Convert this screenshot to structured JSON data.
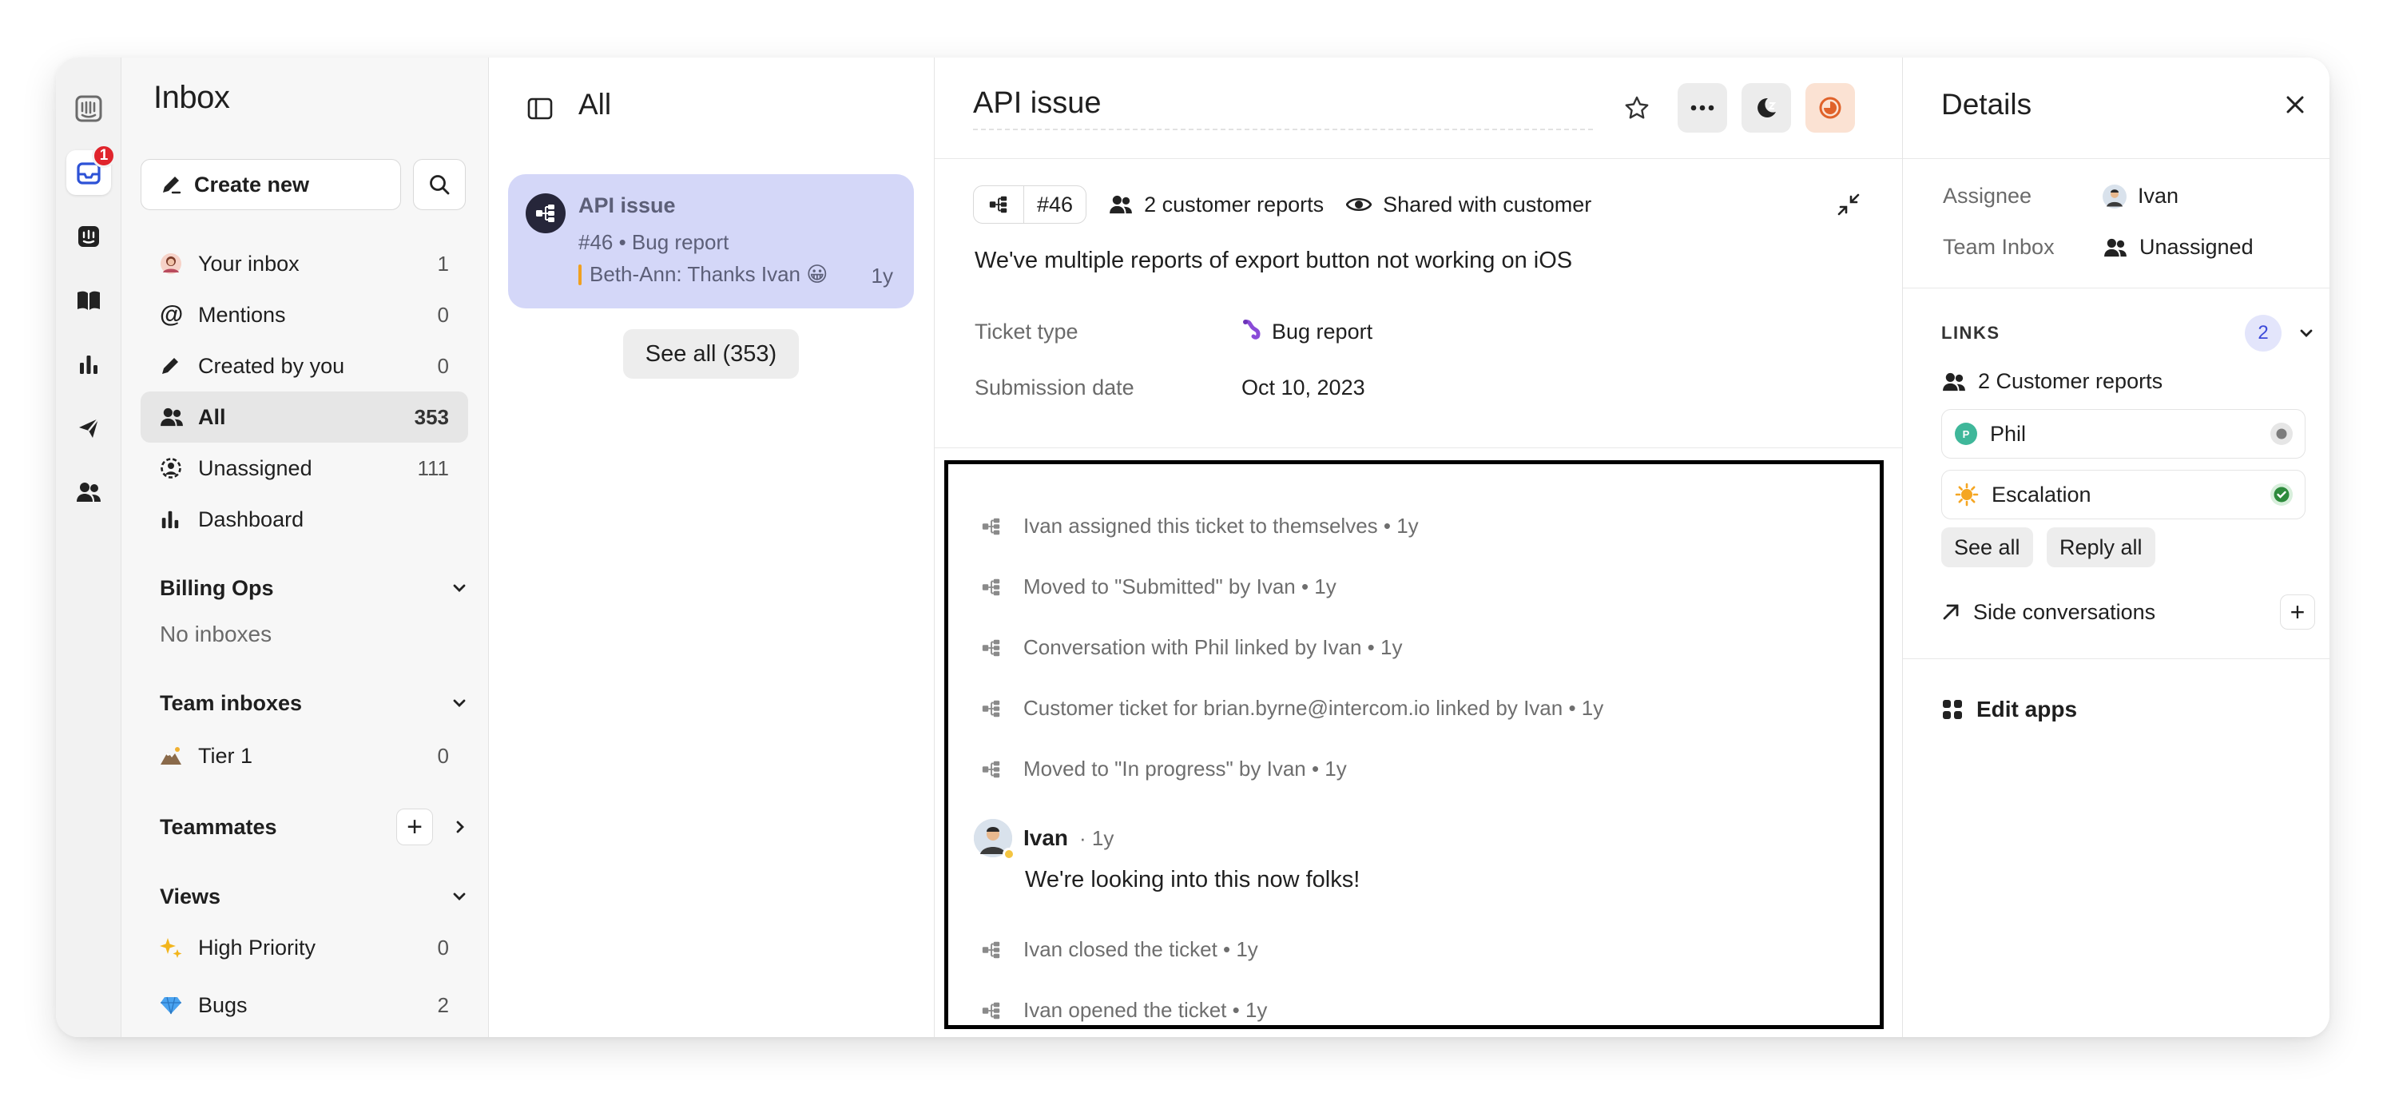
{
  "sidebar": {
    "title": "Inbox",
    "create_label": "Create new",
    "badge": "1",
    "items": [
      {
        "label": "Your inbox",
        "count": "1"
      },
      {
        "label": "Mentions",
        "count": "0"
      },
      {
        "label": "Created by you",
        "count": "0"
      },
      {
        "label": "All",
        "count": "353"
      },
      {
        "label": "Unassigned",
        "count": "111"
      },
      {
        "label": "Dashboard",
        "count": ""
      }
    ],
    "billing": {
      "title": "Billing Ops",
      "empty": "No inboxes"
    },
    "team_inboxes": {
      "title": "Team inboxes",
      "items": [
        {
          "label": "Tier 1",
          "count": "0"
        }
      ]
    },
    "teammates": {
      "title": "Teammates"
    },
    "views": {
      "title": "Views",
      "items": [
        {
          "label": "High Priority",
          "count": "0"
        },
        {
          "label": "Bugs",
          "count": "2"
        }
      ]
    }
  },
  "list": {
    "title": "All",
    "conversation": {
      "title": "API issue",
      "subtitle": "#46 • Bug report",
      "preview": "Beth-Ann: Thanks Ivan 😀",
      "time": "1y"
    },
    "see_all": "See all (353)"
  },
  "ticket": {
    "title": "API issue",
    "id": "#46",
    "reports": "2 customer reports",
    "shared": "Shared with customer",
    "description": "We've multiple reports of export button not working on iOS",
    "attributes": [
      {
        "label": "Ticket type",
        "value": "Bug report",
        "icon": "🪱"
      },
      {
        "label": "Submission date",
        "value": "Oct 10, 2023"
      }
    ],
    "events": [
      "Ivan assigned this ticket to themselves • 1y",
      "Moved to \"Submitted\" by Ivan • 1y",
      "Conversation with Phil linked by Ivan • 1y",
      "Customer ticket for brian.byrne@intercom.io linked by Ivan • 1y",
      "Moved to \"In progress\" by Ivan • 1y"
    ],
    "comment": {
      "author": "Ivan",
      "time": "· 1y",
      "body": "We're looking into this now folks!"
    },
    "events_after": [
      "Ivan closed the ticket • 1y",
      "Ivan opened the ticket • 1y"
    ]
  },
  "details": {
    "title": "Details",
    "assignee_label": "Assignee",
    "assignee": "Ivan",
    "team_label": "Team Inbox",
    "team": "Unassigned",
    "links_label": "LINKS",
    "links_count": "2",
    "customer_reports": "2 Customer reports",
    "links": [
      {
        "name": "Phil",
        "initial": "P",
        "status_color": "#8a8a8a"
      },
      {
        "name": "Escalation",
        "initial": "☀️",
        "status_color": "#2e8b3d"
      }
    ],
    "see_all": "See all",
    "reply_all": "Reply all",
    "side_conversations": "Side conversations",
    "edit_apps": "Edit apps"
  },
  "colors": {
    "accent": "#3d4bd9",
    "badge": "#e0242c",
    "selected_card": "#d4d7f8"
  }
}
